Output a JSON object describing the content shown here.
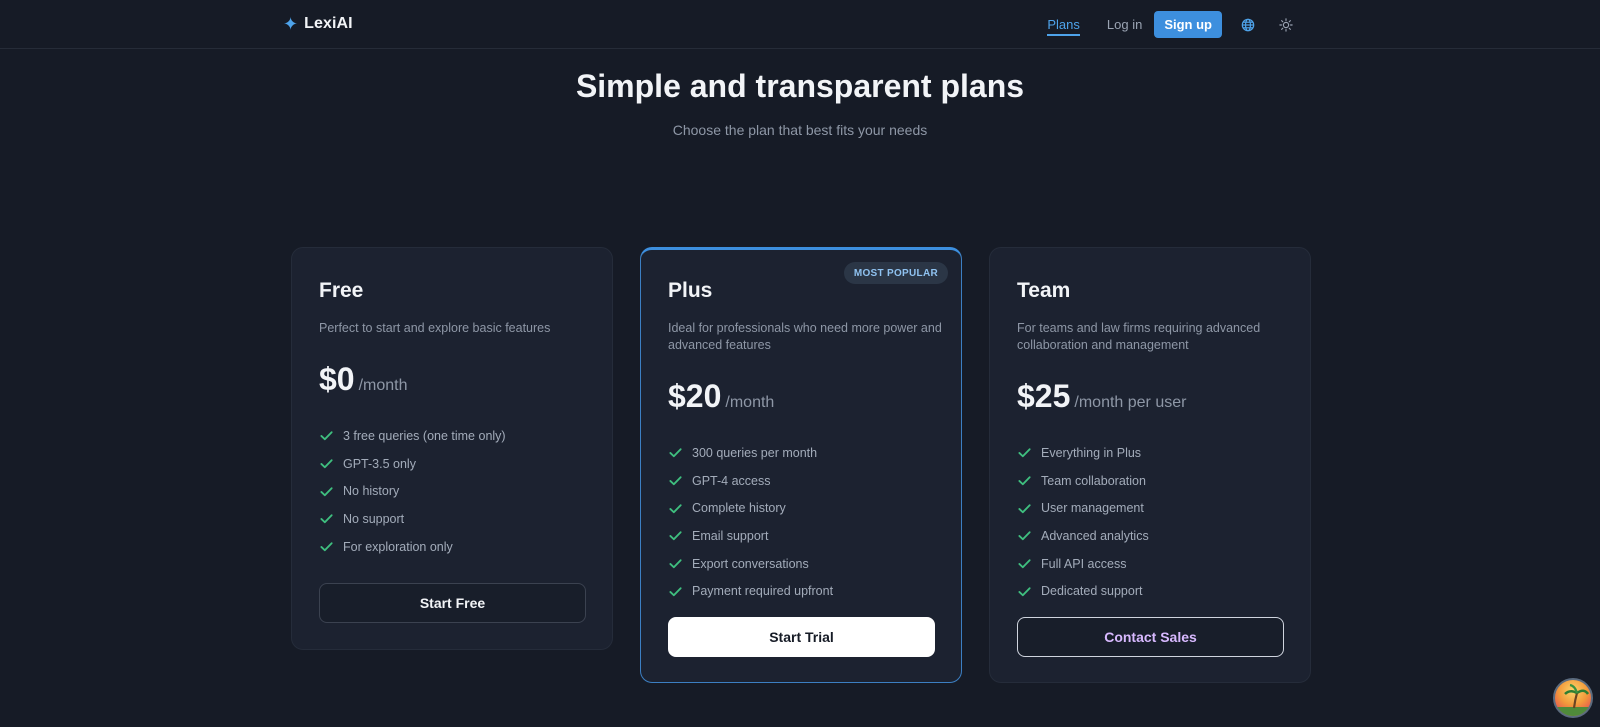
{
  "brand": {
    "logo_icon": "sparkle-icon",
    "name": "LexiAI",
    "accent": "#3d8fde"
  },
  "nav": {
    "plans": "Plans",
    "login": "Log in",
    "signup": "Sign up",
    "language_icon": "globe-icon",
    "theme_icon": "sun-icon"
  },
  "hero": {
    "title": "Simple and transparent plans",
    "subtitle": "Choose the plan that best fits your needs"
  },
  "plans": [
    {
      "name": "Free",
      "description": "Perfect to start and explore basic features",
      "price": "$0",
      "unit": "/month",
      "features": [
        "3 free queries (one time only)",
        "GPT-3.5 only",
        "No history",
        "No support",
        "For exploration only"
      ],
      "cta": "Start Free"
    },
    {
      "name": "Plus",
      "badge": "MOST POPULAR",
      "description": "Ideal for professionals who need more power and advanced features",
      "price": "$20",
      "unit": "/month",
      "features": [
        "300 queries per month",
        "GPT-4 access",
        "Complete history",
        "Email support",
        "Export conversations",
        "Payment required upfront"
      ],
      "cta": "Start Trial"
    },
    {
      "name": "Team",
      "description": "For teams and law firms requiring advanced collaboration and management",
      "price": "$25",
      "unit": "/month per user",
      "features": [
        "Everything in Plus",
        "Team collaboration",
        "User management",
        "Advanced analytics",
        "Full API access",
        "Dedicated support"
      ],
      "cta": "Contact Sales"
    }
  ],
  "colors": {
    "check": "#3fbf7f",
    "background": "#161b26",
    "card": "#1c2230"
  }
}
